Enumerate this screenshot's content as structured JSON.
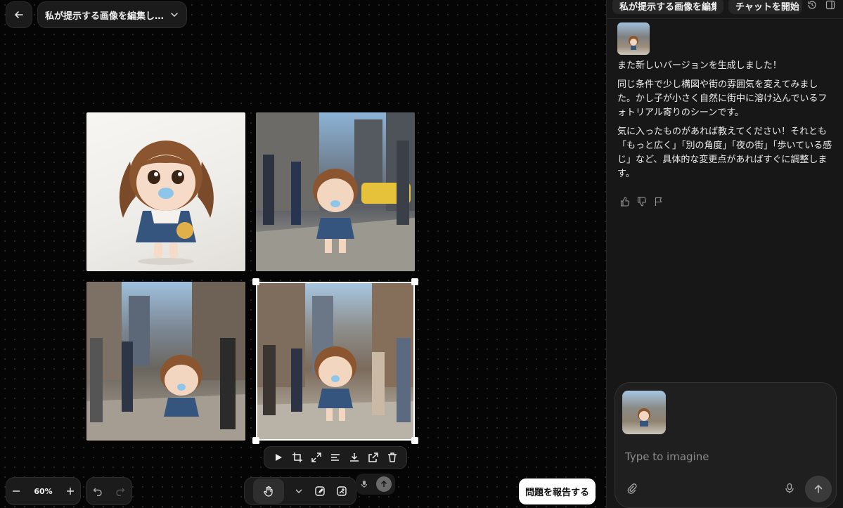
{
  "header": {
    "title": "私が提示する画像を編集し…"
  },
  "canvas": {
    "images": [
      {
        "alt": "chibi girl with pacifier, white background"
      },
      {
        "alt": "chibi girl on city sidewalk"
      },
      {
        "alt": "chibi girl walking among pedestrians"
      },
      {
        "alt": "chibi girl on busy street (selected)"
      }
    ],
    "zoom": "60%",
    "report_label": "問題を報告する"
  },
  "panel": {
    "title_chip": "私が提示する画像を編集し",
    "new_chat_label": "チャットを開始",
    "message": {
      "p1": "また新しいバージョンを生成しました！",
      "p2": "同じ条件で少し構図や街の雰囲気を変えてみました。かし子が小さく自然に街中に溶け込んでいるフォトリアル寄りのシーンです。",
      "p3": "気に入ったものがあれば教えてください！それとも「もっと広く」「別の角度」「夜の街」「歩いている感じ」など、具体的な変更点があればすぐに調整します。"
    },
    "composer": {
      "placeholder": "Type to imagine"
    }
  },
  "colors": {
    "canvas_bg": "#050505",
    "panel_bg": "#171717",
    "selection": "#ffffff"
  }
}
